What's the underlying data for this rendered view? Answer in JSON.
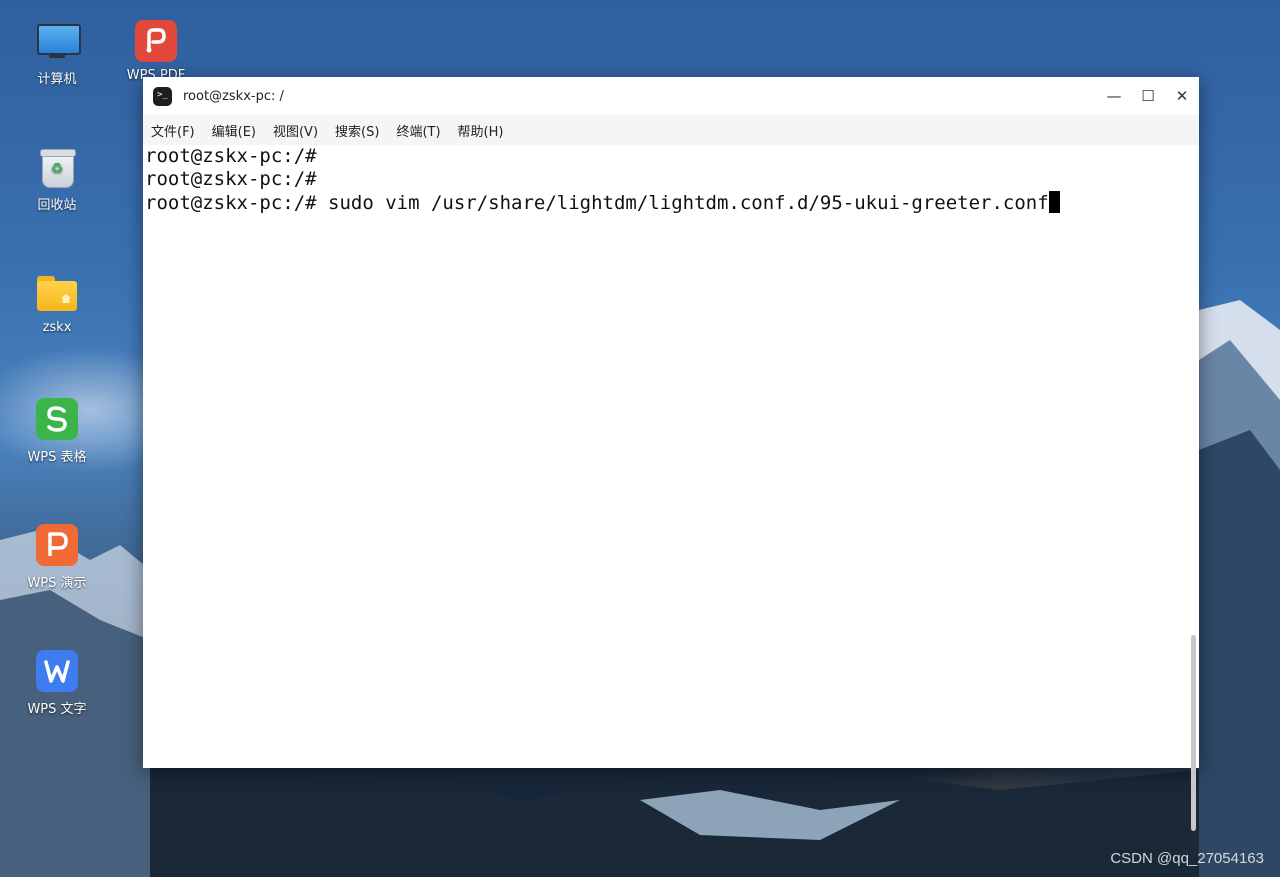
{
  "desktop": {
    "icons": [
      {
        "label": "计算机",
        "icon": "computer-icon"
      },
      {
        "label": "WPS PDF",
        "icon": "wps-pdf-icon"
      },
      {
        "label": "回收站",
        "icon": "trash-icon"
      },
      {
        "label": "zskx",
        "icon": "home-folder-icon"
      },
      {
        "label": "WPS 表格",
        "icon": "wps-spreadsheet-icon"
      },
      {
        "label": "WPS 演示",
        "icon": "wps-presentation-icon"
      },
      {
        "label": "WPS 文字",
        "icon": "wps-writer-icon"
      }
    ],
    "watermark": "CSDN @qq_27054163"
  },
  "window": {
    "title": "root@zskx-pc: /",
    "buttons": {
      "minimize": "—",
      "maximize": "☐",
      "close": "✕"
    },
    "menu": [
      "文件(F)",
      "编辑(E)",
      "视图(V)",
      "搜索(S)",
      "终端(T)",
      "帮助(H)"
    ],
    "terminal_lines": [
      "root@zskx-pc:/#",
      "root@zskx-pc:/#",
      "root@zskx-pc:/# sudo vim /usr/share/lightdm/lightdm.conf.d/95-ukui-greeter.conf"
    ]
  },
  "colors": {
    "accent_pdf": "#e2483b",
    "accent_sheet": "#3bb54a",
    "accent_ppt": "#f06a35",
    "accent_writer": "#3e7cf0"
  }
}
